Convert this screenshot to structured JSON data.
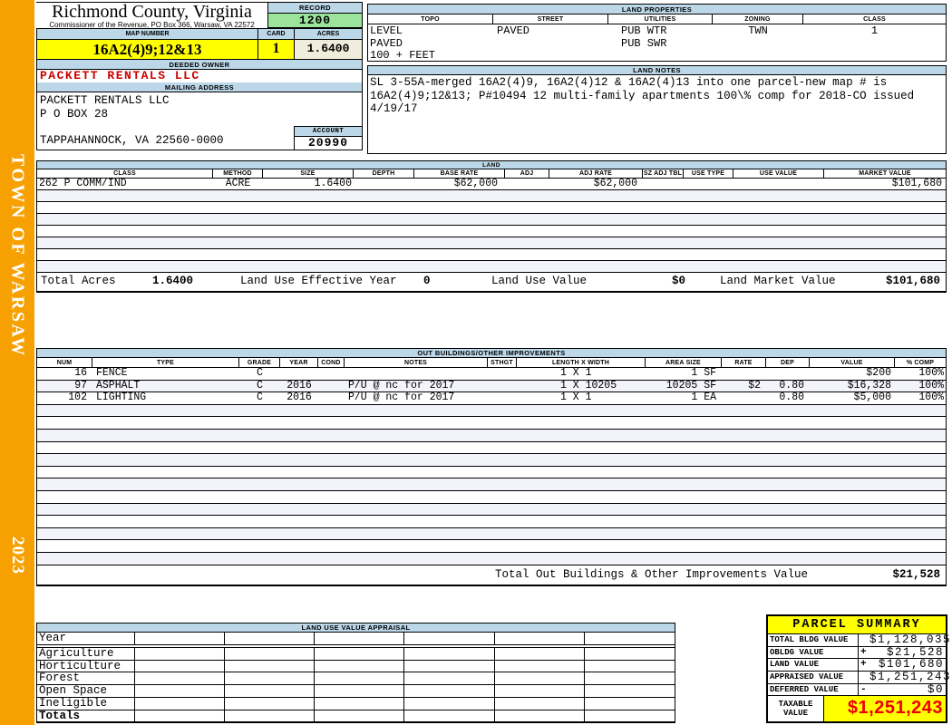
{
  "sidebar": {
    "town": "TOWN OF WARSAW",
    "year": "2023"
  },
  "header": {
    "county_title": "Richmond County, Virginia",
    "commissioner_line": "Commissioner of the Revenue, PO Box 366, Warsaw, VA 22572",
    "record_label": "RECORD",
    "record_value": "1200",
    "map_number_label": "MAP NUMBER",
    "map_number_value": "16A2(4)9;12&13",
    "card_label": "CARD",
    "card_value": "1",
    "acres_label": "ACRES",
    "acres_value": "1.6400",
    "deeded_owner_label": "DEEDED OWNER",
    "deeded_owner": "PACKETT RENTALS LLC",
    "mailing_address_label": "MAILING ADDRESS",
    "mailing_address_lines": [
      "PACKETT RENTALS LLC",
      "P O BOX 28",
      "",
      "TAPPAHANNOCK, VA 22560-0000"
    ],
    "account_label": "ACCOUNT",
    "account_value": "20990"
  },
  "land_properties": {
    "title": "LAND PROPERTIES",
    "columns": [
      "TOPO",
      "STREET",
      "UTILITIES",
      "ZONING",
      "CLASS"
    ],
    "rows": [
      [
        "LEVEL",
        "PAVED",
        "PUB WTR",
        "TWN",
        "1"
      ],
      [
        "PAVED",
        "",
        "PUB SWR",
        "",
        ""
      ],
      [
        "100 + FEET",
        "",
        "",
        "",
        ""
      ]
    ]
  },
  "land_notes": {
    "title": "LAND NOTES",
    "lines": [
      "SL 3-55A-merged 16A2(4)9, 16A2(4)12 & 16A2(4)13 into one parcel-new map # is",
      "16A2(4)9;12&13; P#10494 12 multi-family apartments 100\\% comp for 2018-CO issued",
      "4/19/17"
    ]
  },
  "land": {
    "title": "LAND",
    "columns": [
      "CLASS",
      "METHOD",
      "SIZE",
      "DEPTH",
      "BASE RATE",
      "ADJ",
      "ADJ RATE",
      "SZ ADJ TBL",
      "USE TYPE",
      "USE VALUE",
      "MARKET VALUE"
    ],
    "rows": [
      [
        "262 P COMM/IND",
        "ACRE",
        "1.6400",
        "",
        "$62,000",
        "",
        "$62,000",
        "",
        "",
        "",
        "$101,680"
      ]
    ],
    "empty_row_count": 7,
    "totals": {
      "total_acres_label": "Total Acres",
      "total_acres": "1.6400",
      "effective_year_label": "Land Use Effective Year",
      "effective_year": "0",
      "use_value_label": "Land Use Value",
      "use_value": "$0",
      "market_value_label": "Land Market Value",
      "market_value": "$101,680"
    }
  },
  "out_buildings": {
    "title": "OUT BUILDINGS/OTHER IMPROVEMENTS",
    "columns": [
      "NUM",
      "TYPE",
      "GRADE",
      "YEAR",
      "COND",
      "NOTES",
      "STHGT",
      "LENGTH X WIDTH",
      "AREA SIZE",
      "RATE",
      "DEP",
      "VALUE",
      "% COMP"
    ],
    "rows": [
      [
        "16",
        "FENCE",
        "C",
        "",
        "",
        "",
        "",
        "1 X 1",
        "1 SF",
        "",
        "",
        "$200",
        "100%"
      ],
      [
        "97",
        "ASPHALT",
        "C",
        "2016",
        "",
        "P/U @ nc for 2017",
        "",
        "1 X 10205",
        "10205 SF",
        "$2",
        "0.80",
        "$16,328",
        "100%"
      ],
      [
        "102",
        "LIGHTING",
        "C",
        "2016",
        "",
        "P/U @ nc for 2017",
        "",
        "1 X 1",
        "1 EA",
        "",
        "0.80",
        "$5,000",
        "100%"
      ]
    ],
    "empty_row_count": 13,
    "total_label": "Total Out Buildings & Other Improvements Value",
    "total_value": "$21,528"
  },
  "land_use_appraisal": {
    "title": "LAND USE VALUE APPRAISAL",
    "row_labels": [
      "Year",
      "Agriculture",
      "Horticulture",
      "Forest",
      "Open Space",
      "Ineligible",
      "Totals"
    ],
    "data_column_count": 6
  },
  "parcel_summary": {
    "title": "PARCEL SUMMARY",
    "rows": [
      {
        "label": "TOTAL BLDG VALUE",
        "op": "",
        "value": "$1,128,035"
      },
      {
        "label": "OBLDG VALUE",
        "op": "+",
        "value": "$21,528"
      },
      {
        "label": "LAND VALUE",
        "op": "+",
        "value": "$101,680"
      },
      {
        "label": "APPRAISED VALUE",
        "op": "",
        "value": "$1,251,243"
      },
      {
        "label": "DEFERRED VALUE",
        "op": "-",
        "value": "$0"
      }
    ],
    "taxable_label": "TAXABLE VALUE",
    "taxable_value": "$1,251,243"
  },
  "colors": {
    "sidebar_orange": "#F6A101",
    "header_blue": "#BCD8E8",
    "record_green": "#9CE49C",
    "highlight_yellow": "#FFFF00",
    "acres_cream": "#F0EDDC",
    "owner_red": "#CC0000",
    "taxable_red": "#EE0000"
  }
}
